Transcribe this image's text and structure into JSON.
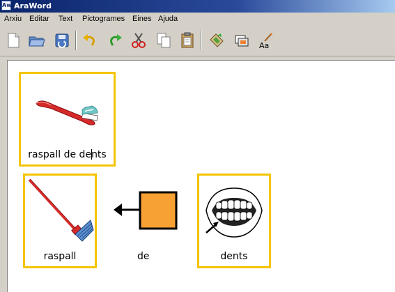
{
  "window": {
    "title": "AraWord",
    "app_icon_text": "Aw"
  },
  "menu": [
    "Arxiu",
    "Editar",
    "Text",
    "Pictogrames",
    "Eines",
    "Ajuda"
  ],
  "toolbar": {
    "buttons": [
      "new-document-icon",
      "open-folder-icon",
      "save-icon",
      "undo-icon",
      "redo-icon",
      "cut-icon",
      "copy-icon",
      "paste-icon",
      "change-pictogram-icon",
      "pictogram-panel-icon",
      "text-style-icon"
    ],
    "text_style_label": "Aa"
  },
  "document": {
    "pictograms": [
      {
        "label_before_caret": "raspall de de",
        "label_after_caret": "nts",
        "image": "toothbrush-icon"
      },
      {
        "label": "raspall",
        "image": "broom-icon"
      },
      {
        "label": "de",
        "image": "from-arrow-icon"
      },
      {
        "label": "dents",
        "image": "teeth-icon"
      }
    ]
  },
  "colors": {
    "pictogram_border": "#f5c400",
    "toothbrush": "#d62a2a",
    "de_square": "#f7a033"
  }
}
